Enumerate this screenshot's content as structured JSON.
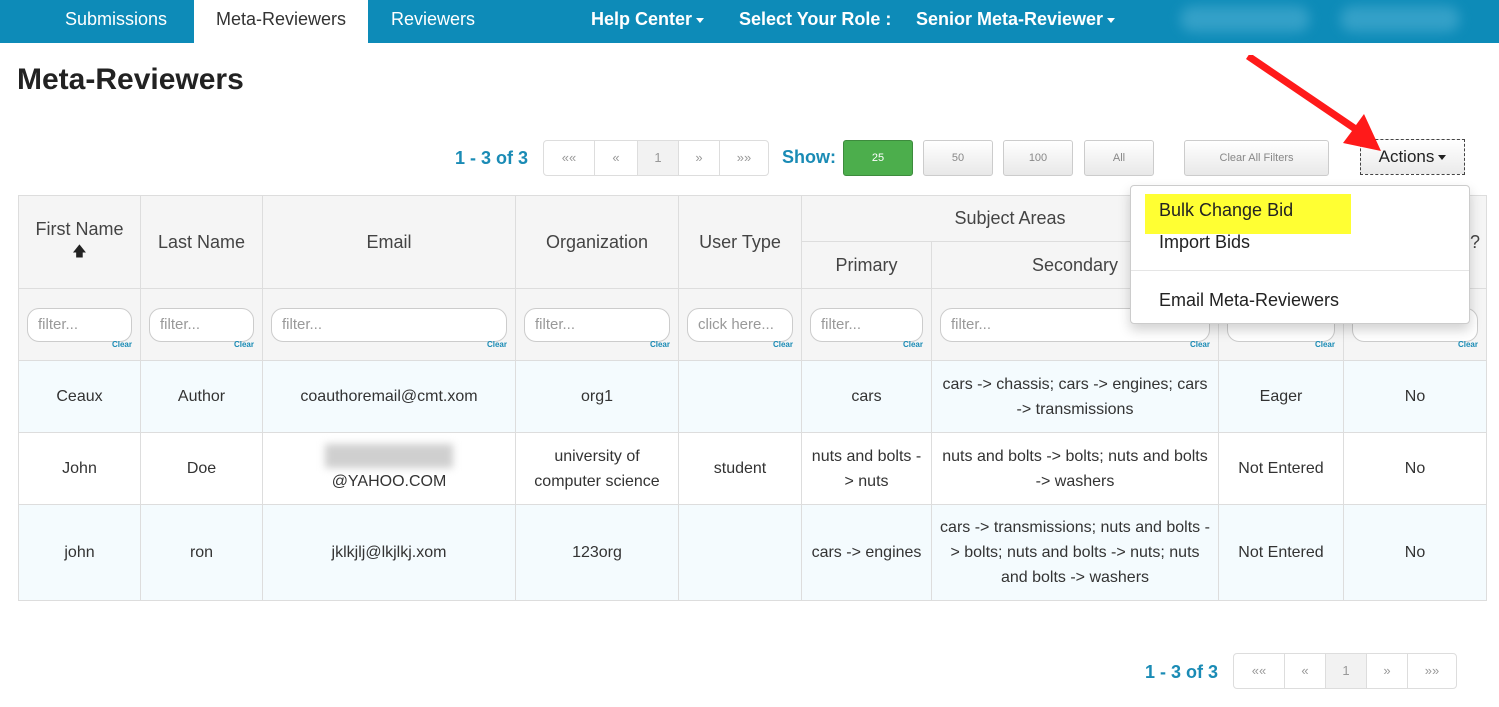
{
  "nav": {
    "tabs": [
      {
        "label": "Submissions"
      },
      {
        "label": "Meta-Reviewers"
      },
      {
        "label": "Reviewers"
      }
    ],
    "help_center": "Help Center",
    "role_label": "Select Your Role :",
    "role_value": "Senior Meta-Reviewer"
  },
  "page_title": "Meta-Reviewers",
  "pager": {
    "count": "1 - 3 of 3",
    "first": "««",
    "prev": "«",
    "page": "1",
    "next": "»",
    "last": "»»"
  },
  "show": {
    "label": "Show:",
    "options": [
      "25",
      "50",
      "100",
      "All"
    ],
    "selected": "25"
  },
  "clear_all_filters": "Clear All Filters",
  "actions": {
    "label": "Actions",
    "items": [
      "Bulk Change Bid",
      "Import Bids",
      "Email Meta-Reviewers"
    ],
    "highlighted": "Bulk Change Bid"
  },
  "table": {
    "headers": {
      "first_name": "First Name",
      "last_name": "Last Name",
      "email": "Email",
      "organization": "Organization",
      "user_type": "User Type",
      "subject_areas": "Subject Areas",
      "primary": "Primary",
      "secondary": "Secondary",
      "last": "?"
    },
    "filter_placeholder": "filter...",
    "click_placeholder": "click here...",
    "clear_label": "Clear",
    "rows": [
      {
        "first": "Ceaux",
        "last": "Author",
        "email": "coauthoremail@cmt.xom",
        "org": "org1",
        "type": "",
        "primary": "cars",
        "secondary": "cars -> chassis; cars -> engines; cars -> transmissions",
        "bid": "Eager",
        "conflict": "No"
      },
      {
        "first": "John",
        "last": "Doe",
        "email": "@YAHOO.COM",
        "org": "university of computer science",
        "type": "student",
        "primary": "nuts and bolts -> nuts",
        "secondary": "nuts and bolts -> bolts; nuts and bolts -> washers",
        "bid": "Not Entered",
        "conflict": "No"
      },
      {
        "first": "john",
        "last": "ron",
        "email": "jklkjlj@lkjlkj.xom",
        "org": "123org",
        "type": "",
        "primary": "cars -> engines",
        "secondary": "cars -> transmissions; nuts and bolts -> bolts; nuts and bolts -> nuts; nuts and bolts -> washers",
        "bid": "Not Entered",
        "conflict": "No"
      }
    ]
  },
  "colors": {
    "nav_bg": "#0d8bb8",
    "link": "#1a8bb5",
    "show_active": "#4cae4c",
    "highlight": "#ffff33",
    "arrow": "#ff1a1a"
  }
}
